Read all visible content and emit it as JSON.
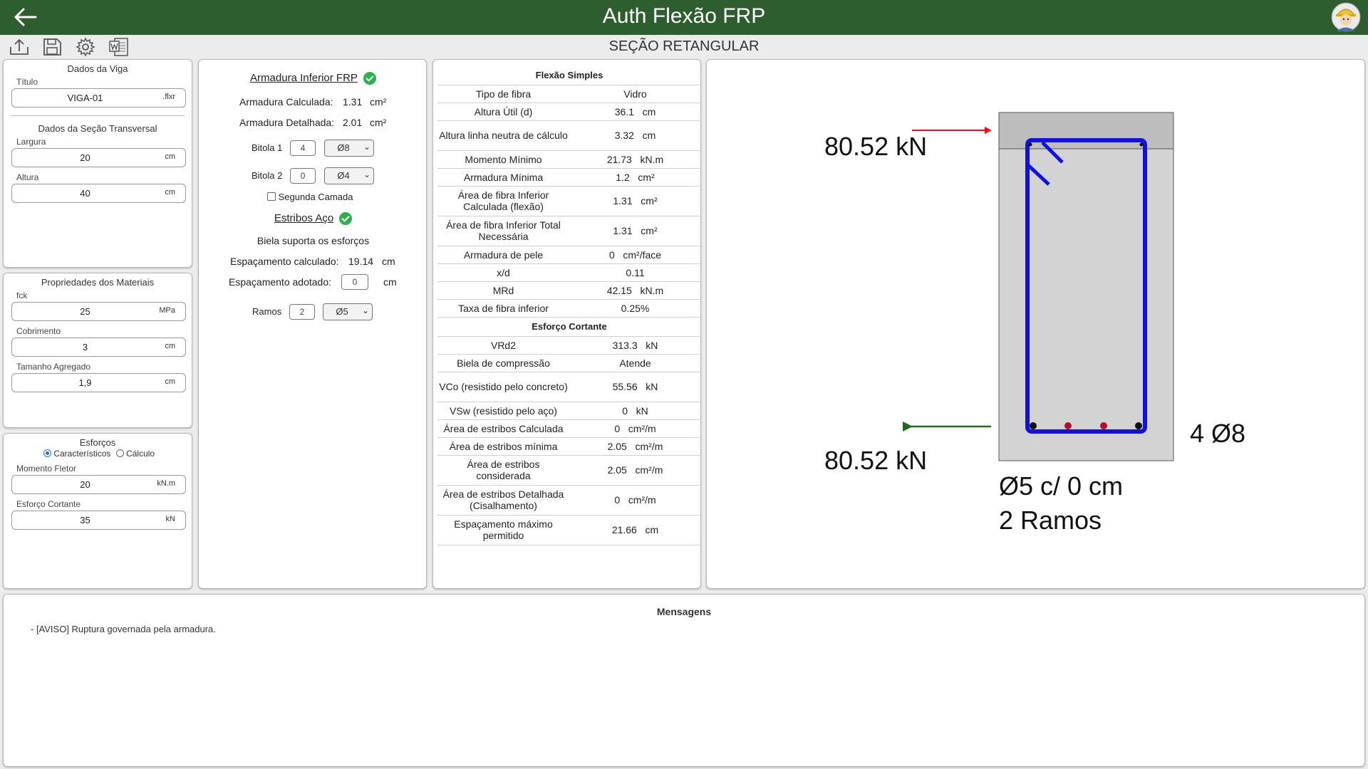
{
  "app": {
    "title": "Auth Flexão FRP"
  },
  "page": {
    "section_title": "SEÇÃO RETANGULAR"
  },
  "beam": {
    "panel_title": "Dados da Viga",
    "title_label": "Título",
    "title_value": "VIGA-01",
    "title_ext": ".flxr",
    "section_title": "Dados da Seção Transversal",
    "width_label": "Largura",
    "width_value": "20",
    "width_unit": "cm",
    "height_label": "Altura",
    "height_value": "40",
    "height_unit": "cm"
  },
  "materials": {
    "panel_title": "Propriedades dos Materiais",
    "fck_label": "fck",
    "fck_value": "25",
    "fck_unit": "MPa",
    "cover_label": "Cobrimento",
    "cover_value": "3",
    "cover_unit": "cm",
    "aggregate_label": "Tamanho Agregado",
    "aggregate_value": "1,9",
    "aggregate_unit": "cm"
  },
  "efforts": {
    "panel_title": "Esforços",
    "radio_characteristic": "Característicos",
    "radio_calc": "Cálculo",
    "moment_label": "Momento Fletor",
    "moment_value": "20",
    "moment_unit": "kN.m",
    "shear_label": "Esforço Cortante",
    "shear_value": "35",
    "shear_unit": "kN"
  },
  "reinforcement": {
    "frp_title": "Armadura Inferior FRP",
    "calc_label": "Armadura Calculada:",
    "calc_value": "1.31",
    "calc_unit": "cm²",
    "detail_label": "Armadura Detalhada:",
    "detail_value": "2.01",
    "detail_unit": "cm²",
    "bitola1_label": "Bitola 1",
    "bitola1_count": "4",
    "bitola1_size": "Ø8",
    "bitola2_label": "Bitola 2",
    "bitola2_count": "0",
    "bitola2_size": "Ø4",
    "second_layer_label": "Segunda Camada",
    "stirrups_title": "Estribos Aço",
    "strut_text": "Biela suporta os esforços",
    "spacing_calc_label": "Espaçamento calculado:",
    "spacing_calc_value": "19.14",
    "spacing_calc_unit": "cm",
    "spacing_adopted_label": "Espaçamento adotado:",
    "spacing_adopted_value": "0",
    "spacing_adopted_unit": "cm",
    "branches_label": "Ramos",
    "branches_value": "2",
    "branches_size": "Ø5"
  },
  "results": {
    "flexure_title": "Flexão Simples",
    "flexure_rows": [
      {
        "label": "Tipo de fibra",
        "value": "Vidro"
      },
      {
        "label": "Altura Útil (d)",
        "value": "36.1   cm"
      },
      {
        "label": "Altura linha neutra de cálculo",
        "value": "3.32   cm"
      },
      {
        "label": "Momento Mínimo",
        "value": "21.73   kN.m"
      },
      {
        "label": "Armadura Mínima",
        "value": "1.2   cm²"
      },
      {
        "label": "Área de fibra Inferior Calculada (flexão)",
        "value": "1.31   cm²"
      },
      {
        "label": "Área de fibra Inferior Total Necessária",
        "value": "1.31   cm²"
      },
      {
        "label": "Armadura de pele",
        "value": "0   cm²/face"
      },
      {
        "label": "x/d",
        "value": "0.11"
      },
      {
        "label": "MRd",
        "value": "42.15   kN.m"
      },
      {
        "label": "Taxa de fibra inferior",
        "value": "0.25%"
      }
    ],
    "shear_title": "Esforço Cortante",
    "shear_rows": [
      {
        "label": "VRd2",
        "value": "313.3   kN"
      },
      {
        "label": "Biela de compressão",
        "value": "Atende"
      },
      {
        "label": "VCo (resistido pelo concreto)",
        "value": "55.56   kN"
      },
      {
        "label": "VSw (resistido pelo aço)",
        "value": "0   kN"
      },
      {
        "label": "Área de estribos Calculada",
        "value": "0   cm²/m"
      },
      {
        "label": "Área de estribos mínima",
        "value": "2.05   cm²/m"
      },
      {
        "label": "Área de estribos considerada",
        "value": "2.05   cm²/m"
      },
      {
        "label": "Área de estribos Detalhada (Cisalhamento)",
        "value": "0   cm²/m"
      },
      {
        "label": "Espaçamento máximo permitido",
        "value": "21.66   cm"
      }
    ]
  },
  "drawing": {
    "force_top": "80.52 kN",
    "force_bottom": "80.52 kN",
    "bars_label": "4 Ø8",
    "stirrup_label": "Ø5 c/ 0 cm",
    "branches_label": "2 Ramos",
    "colors": {
      "stirrup": "#1010e0",
      "compression_arrow": "#ee1111",
      "tension_arrow": "#1f6b1f",
      "section": "#d3d3d3",
      "compressed_zone": "#bdbdbd"
    }
  },
  "messages": {
    "title": "Mensagens",
    "items": [
      "- [AVISO] Ruptura governada pela armadura."
    ]
  },
  "icons": [
    "back-arrow-icon",
    "avatar-icon",
    "upload-icon",
    "save-icon",
    "gear-icon",
    "word-icon",
    "check-circle-icon"
  ]
}
